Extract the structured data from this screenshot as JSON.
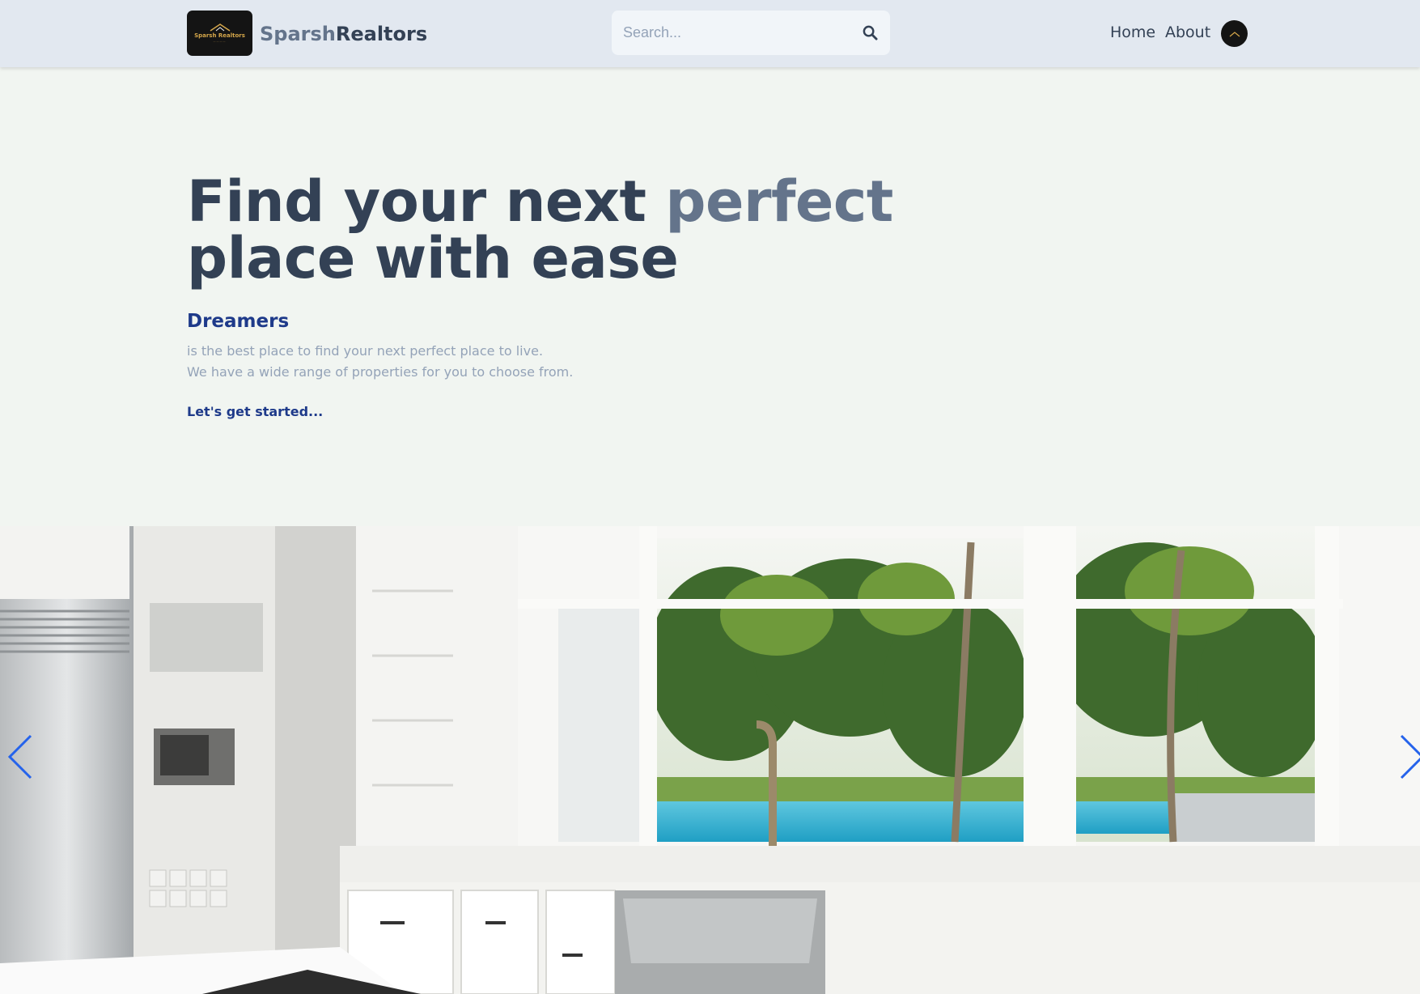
{
  "header": {
    "logo_text": "Sparsh Realtors",
    "brand_primary": "Sparsh",
    "brand_secondary": "Realtors",
    "search_placeholder": "Search...",
    "nav": {
      "home": "Home",
      "about": "About"
    },
    "icons": {
      "search": "search-icon",
      "avatar": "avatar"
    }
  },
  "hero": {
    "title_part1": "Find your next ",
    "title_accent": "perfect",
    "title_part2": "place with ease",
    "subtitle": "Dreamers",
    "description_line1": "is the best place to find your next perfect place to live.",
    "description_line2": "We have a wide range of properties for you to choose from.",
    "cta_label": "Let's get started..."
  },
  "slider": {
    "image_subject": "kitchen with window view of pool and palm trees",
    "prev_icon": "chevron-left-icon",
    "next_icon": "chevron-right-icon"
  },
  "colors": {
    "header_bg": "#e2e8f0",
    "page_bg": "#f1f5f1",
    "title_dark": "#334155",
    "title_accent": "#64748b",
    "link_blue": "#1e3a8a",
    "muted_text": "#94a3b8",
    "arrow_blue": "#2563eb"
  }
}
